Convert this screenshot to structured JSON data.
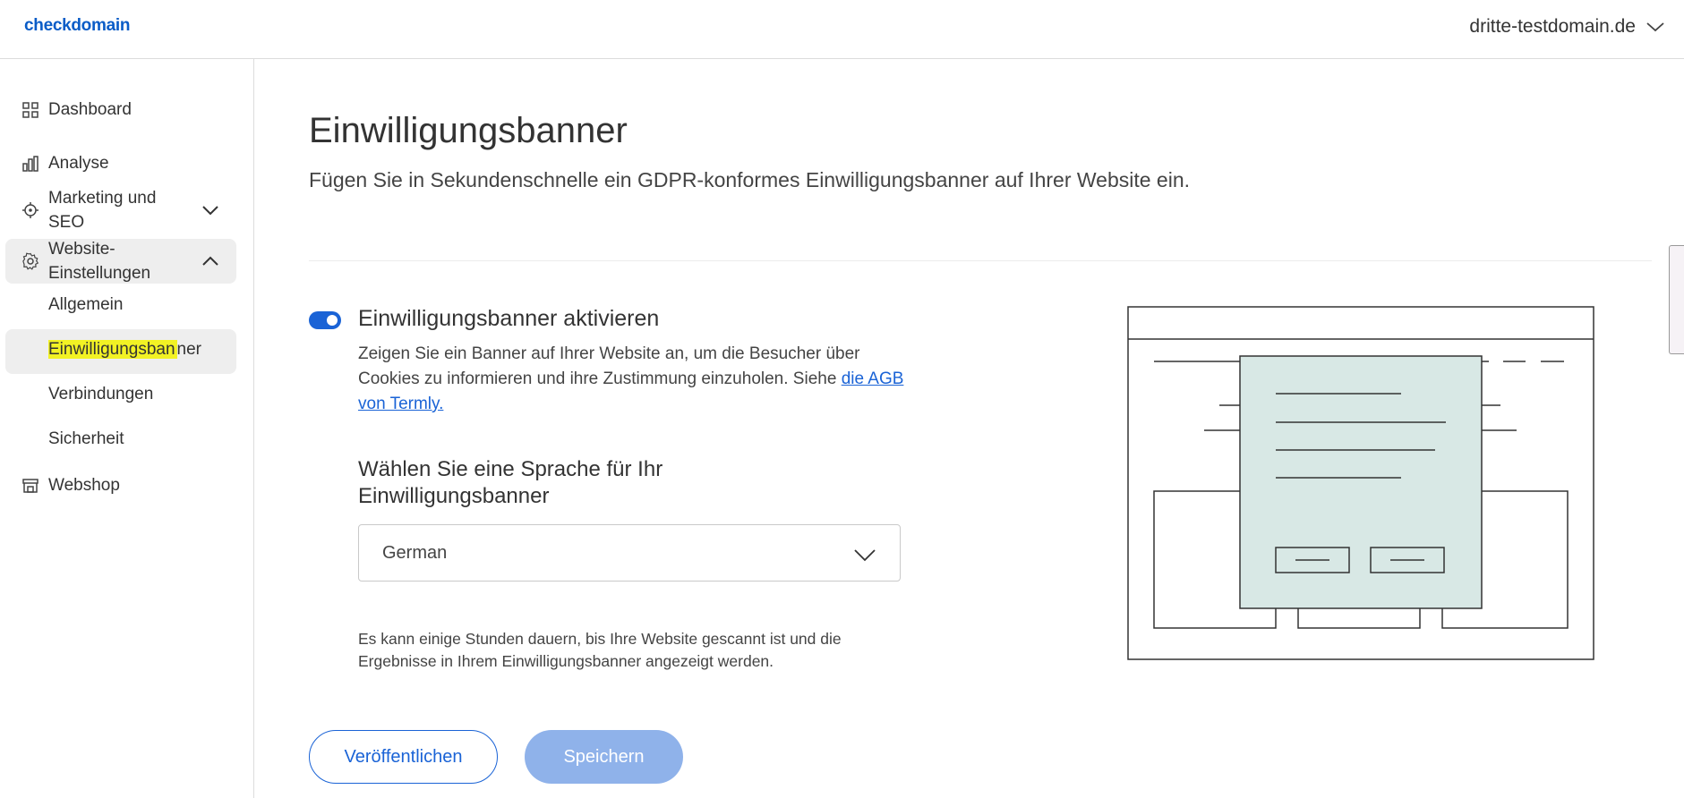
{
  "header": {
    "logo_text": "checkdomain",
    "domain": "dritte-testdomain.de"
  },
  "sidebar": {
    "items": [
      {
        "label": "Dashboard",
        "icon": "grid-icon"
      },
      {
        "label": "Analyse",
        "icon": "bar-chart-icon"
      },
      {
        "label": "Marketing und SEO",
        "icon": "target-icon"
      },
      {
        "label": "Website-Einstellungen",
        "icon": "gear-icon"
      },
      {
        "label": "Webshop",
        "icon": "store-icon"
      }
    ],
    "sub_items": [
      {
        "label": "Allgemein"
      },
      {
        "label_highlight": "Einwilligungsban",
        "label_rest": "ner"
      },
      {
        "label": "Verbindungen"
      },
      {
        "label": "Sicherheit"
      }
    ]
  },
  "main": {
    "title": "Einwilligungsbanner",
    "subtitle": "Fügen Sie in Sekundenschnelle ein GDPR-konformes Einwilligungsbanner auf Ihrer Website ein.",
    "toggle": {
      "label": "Einwilligungsbanner aktivieren",
      "enabled": true
    },
    "description": "Zeigen Sie ein Banner auf Ihrer Website an, um die Besucher über Cookies zu informieren und ihre Zustimmung einzuholen. Siehe ",
    "description_link": "die AGB von Termly.",
    "language_heading": "Wählen Sie eine Sprache für Ihr Einwilligungsbanner",
    "language_value": "German",
    "note": "Es kann einige Stunden dauern, bis Ihre Website gescannt ist und die Ergebnisse in Ihrem Einwilligungsbanner angezeigt werden.",
    "publish_label": "Veröffentlichen",
    "save_label": "Speichern"
  },
  "colors": {
    "accent": "#1a63d6",
    "save_disabled": "#8fb2ea",
    "illustration_fill": "#d8e8e5",
    "highlight": "#f2f224"
  }
}
